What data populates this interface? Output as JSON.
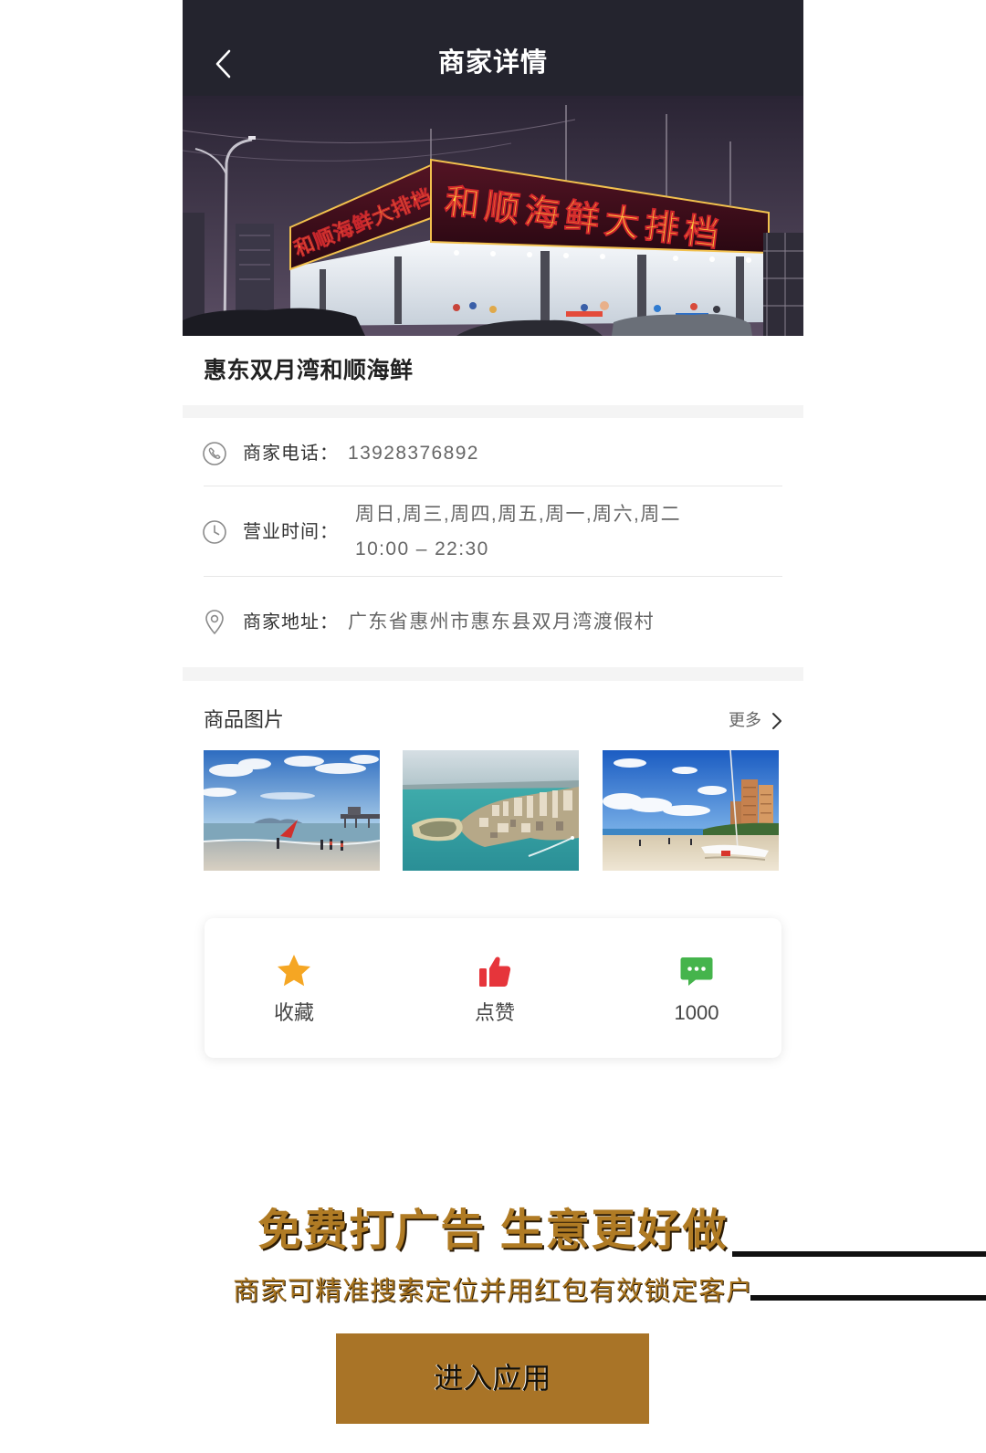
{
  "header": {
    "title": "商家详情",
    "back_icon": "chevron-left-icon"
  },
  "hero": {
    "sign_text": "和顺海鲜大排档"
  },
  "merchant": {
    "name": "惠东双月湾和顺海鲜"
  },
  "info": {
    "phone": {
      "icon": "phone-icon",
      "label": "商家电话：",
      "value": "13928376892"
    },
    "hours": {
      "icon": "clock-icon",
      "label": "营业时间：",
      "days": "周日,周三,周四,周五,周一,周六,周二",
      "time": "10:00 – 22:30"
    },
    "address": {
      "icon": "location-pin-icon",
      "label": "商家地址：",
      "value": "广东省惠州市惠东县双月湾渡假村"
    }
  },
  "gallery": {
    "title": "商品图片",
    "more_label": "更多",
    "more_icon": "chevron-right-icon"
  },
  "actions": [
    {
      "icon": "star-icon",
      "label": "收藏"
    },
    {
      "icon": "thumbs-up-icon",
      "label": "点赞"
    },
    {
      "icon": "chat-bubble-icon",
      "label": "1000"
    }
  ],
  "promo": {
    "headline": "免费打广告 生意更好做",
    "subline": "商家可精准搜索定位并用红包有效锁定客户",
    "button_label": "进入应用"
  },
  "colors": {
    "header_bg": "#24242e",
    "accent_gold": "#a97427",
    "star": "#f5a623",
    "like": "#e6353b",
    "chat": "#45b44c"
  }
}
